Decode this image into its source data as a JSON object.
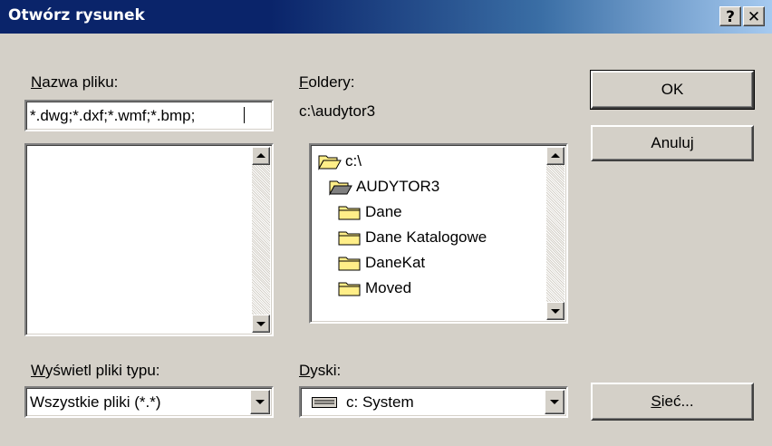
{
  "window": {
    "title": "Otwórz rysunek",
    "help_label": "?",
    "close_label": "✕"
  },
  "filename": {
    "label_accel": "N",
    "label_rest": "azwa pliku:",
    "value": "*.dwg;*.dxf;*.wmf;*.bmp;"
  },
  "folders": {
    "label_accel": "F",
    "label_rest": "oldery:",
    "path": "c:\\audytor3",
    "items": [
      "c:\\",
      "AUDYTOR3",
      "Dane",
      "Dane Katalogowe",
      "DaneKat",
      "Moved"
    ]
  },
  "filetype": {
    "label_accel": "W",
    "label_rest": "yświetl pliki typu:",
    "value": "Wszystkie pliki (*.*)"
  },
  "drives": {
    "label_accel": "D",
    "label_rest": "yski:",
    "value": "c: System"
  },
  "buttons": {
    "ok": "OK",
    "cancel": "Anuluj",
    "network_accel": "S",
    "network_rest": "ieć..."
  },
  "icons": {
    "open_folder": "open-folder-icon",
    "closed_folder": "closed-folder-icon",
    "drive": "hard-drive-icon"
  },
  "colors": {
    "titlebar": "#0a246a",
    "face": "#d4d0c8",
    "folder": "#ffee88"
  }
}
